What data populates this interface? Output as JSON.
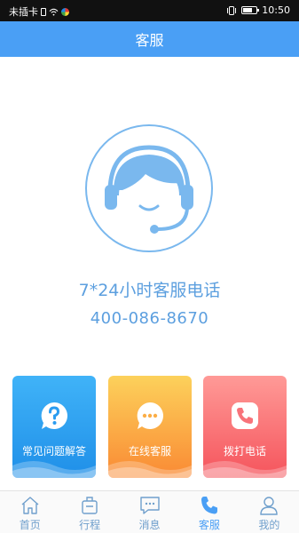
{
  "status_bar": {
    "carrier": "未插卡",
    "time": "10:50",
    "battery_level": 0.7,
    "icons": [
      "sim-card-icon",
      "wifi-icon",
      "app-notification-icon",
      "vibrate-icon",
      "battery-icon"
    ]
  },
  "header": {
    "title": "客服"
  },
  "hotline": {
    "title": "7*24小时客服电话",
    "number": "400-086-8670"
  },
  "cards": [
    {
      "label": "常见问题解答",
      "icon": "question-icon"
    },
    {
      "label": "在线客服",
      "icon": "chat-bubble-icon"
    },
    {
      "label": "拨打电话",
      "icon": "phone-icon"
    }
  ],
  "tabbar": {
    "items": [
      {
        "label": "首页",
        "icon": "home-icon"
      },
      {
        "label": "行程",
        "icon": "luggage-icon"
      },
      {
        "label": "消息",
        "icon": "message-icon"
      },
      {
        "label": "客服",
        "icon": "phone-icon",
        "active": true
      },
      {
        "label": "我的",
        "icon": "user-icon"
      }
    ]
  },
  "colors": {
    "primary": "#4a9ff5",
    "text_blue": "#5c9fdf",
    "faq_card": "#2a9cf0",
    "chat_card": "#fbae46",
    "call_card": "#f8737a"
  }
}
